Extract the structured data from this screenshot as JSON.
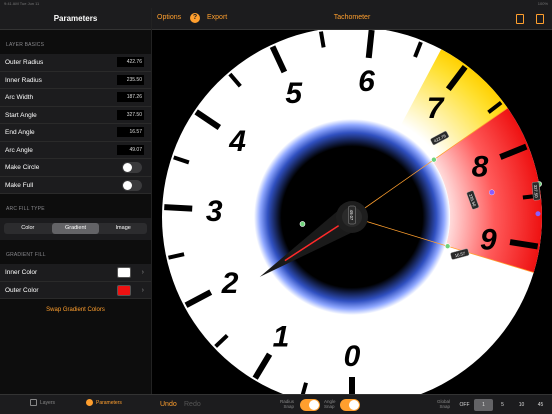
{
  "status": {
    "left": "9:41 AM  Tue Jun 11",
    "right": "100%"
  },
  "sidebar": {
    "title": "Parameters",
    "layer_basics": {
      "title": "LAYER BASICS",
      "rows": [
        {
          "label": "Outer Radius",
          "value": "422.76"
        },
        {
          "label": "Inner Radius",
          "value": "235.50"
        },
        {
          "label": "Arc Width",
          "value": "187.26"
        },
        {
          "label": "Start Angle",
          "value": "327.50"
        },
        {
          "label": "End Angle",
          "value": "16.57"
        },
        {
          "label": "Arc Angle",
          "value": "49.07"
        }
      ],
      "toggles": [
        {
          "label": "Make Circle",
          "on": false
        },
        {
          "label": "Make Full",
          "on": false
        }
      ]
    },
    "arc_fill": {
      "title": "ARC FILL TYPE",
      "options": [
        "Color",
        "Gradient",
        "Image"
      ],
      "selected": "Gradient"
    },
    "gradient": {
      "title": "GRADIENT FILL",
      "inner_label": "Inner Color",
      "inner_color": "#ffffff",
      "outer_label": "Outer Color",
      "outer_color": "#ee1111",
      "swap_label": "Swap Gradient Colors"
    },
    "tabs": {
      "layers": "Layers",
      "parameters": "Parameters"
    }
  },
  "toolbar": {
    "options": "Options",
    "help": "?",
    "export": "Export",
    "title": "Tachometer"
  },
  "bottom": {
    "undo": "Undo",
    "redo": "Redo",
    "radius_snap": [
      "Radius",
      "Snap"
    ],
    "angle_snap": [
      "Angle",
      "Snap"
    ],
    "global_snap": [
      "Global",
      "Snap"
    ],
    "snap_options": [
      "OFF",
      "1",
      "5",
      "10",
      "45"
    ],
    "snap_selected": "1"
  },
  "gauge": {
    "numbers": [
      "0",
      "1",
      "2",
      "3",
      "4",
      "5",
      "6",
      "7",
      "8",
      "9"
    ],
    "handle_labels": [
      "422.76",
      "235.50",
      "327.50",
      "16.57",
      "49.07"
    ],
    "colors": {
      "accent": "#ff9f2e",
      "red_zone": "#ee1111",
      "yellow_zone": "#ffe030",
      "needle": "#ff2a2a"
    }
  }
}
